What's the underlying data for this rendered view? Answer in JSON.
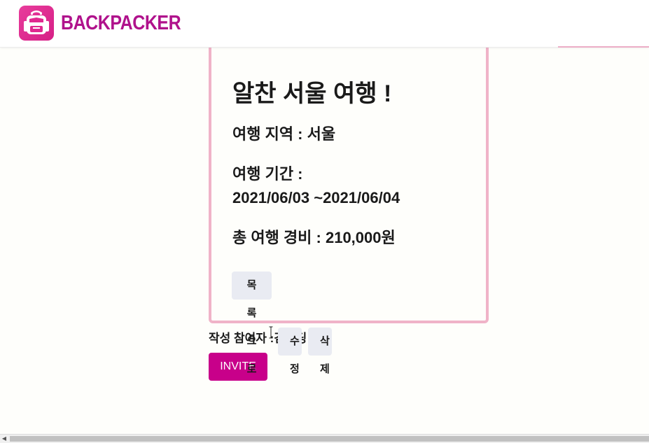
{
  "header": {
    "brand": "BACKPACKER",
    "logo_icon": "backpack-icon",
    "logo_color": "#e0288f",
    "brand_color": "#b0128c"
  },
  "trip": {
    "title": "알찬 서울 여행 !",
    "region": "여행 지역 : 서울",
    "period_label": "여행 기간 :",
    "period_dates": "2021/06/03 ~2021/06/04",
    "total_cost": "총 여행 경비 : 210,000원"
  },
  "actions": {
    "list_label": "목록으로",
    "edit_label": "수정",
    "delete_label": "삭제"
  },
  "participants": {
    "text": "작성 참여자 :김코딩"
  },
  "invite": {
    "label": "INVITE",
    "color": "#c8008a"
  },
  "colors": {
    "card_border": "#f0b3c8",
    "button_bg": "#e9ebf2"
  }
}
